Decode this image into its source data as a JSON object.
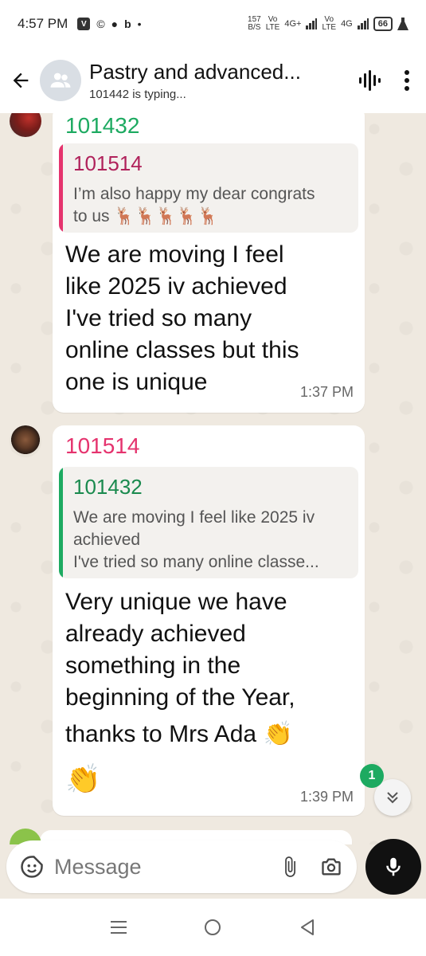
{
  "status_bar": {
    "time": "4:57 PM",
    "app_icons": [
      "V",
      "©",
      "●",
      "b",
      "•"
    ],
    "speed": "157\nB/S",
    "network_1": "Vo\nLTE",
    "network_2": "4G+",
    "network_3": "Vo\nLTE",
    "network_4": "4G",
    "battery": "66"
  },
  "header": {
    "title": "Pastry and advanced...",
    "subtitle": "101442 is typing..."
  },
  "messages": [
    {
      "sender": "101432",
      "sender_color": "#1daa61",
      "quote": {
        "name": "101514",
        "name_color": "#b0225b",
        "bar_color": "#e5336e",
        "line1": "I’m also happy my dear congrats",
        "line2": "to us 🦌🦌🦌🦌🦌"
      },
      "lines": [
        "We are moving I feel",
        "like 2025 iv achieved",
        "I've tried so many",
        "online classes but this",
        "one is unique"
      ],
      "time": "1:37 PM"
    },
    {
      "sender": "101514",
      "sender_color": "#e5336e",
      "quote": {
        "name": "101432",
        "name_color": "#1a8a4e",
        "bar_color": "#1daa61",
        "line1": "We are moving I feel like 2025 iv",
        "line2": "achieved",
        "line3": "I've tried so many online classe..."
      },
      "lines": [
        "Very unique  we have",
        "already achieved",
        "something in the",
        "beginning of the Year,",
        "thanks to Mrs Ada 👏",
        "👏"
      ],
      "time": "1:39 PM"
    }
  ],
  "unread_count": "1",
  "composer": {
    "placeholder": "Message"
  },
  "colors": {
    "accent_green": "#1daa61",
    "chat_background": "#efe9e0"
  }
}
